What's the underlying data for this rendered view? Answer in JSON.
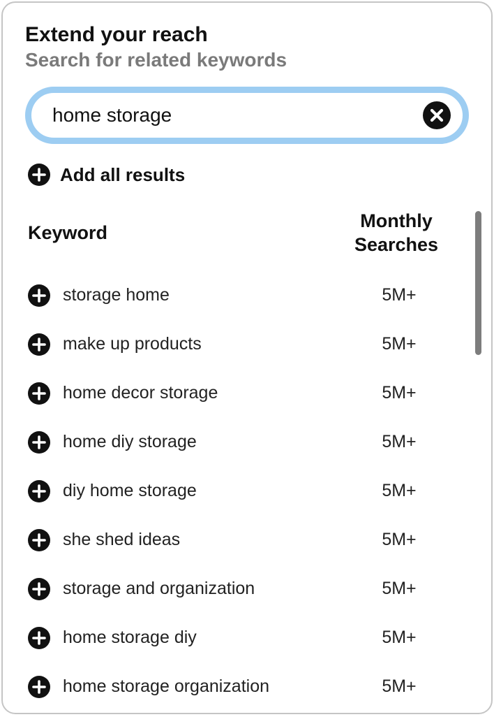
{
  "header": {
    "title": "Extend your reach",
    "subtitle": "Search for related keywords"
  },
  "search": {
    "value": "home storage",
    "placeholder": ""
  },
  "actions": {
    "add_all_label": "Add all results"
  },
  "table": {
    "columns": {
      "keyword": "Keyword",
      "searches_line1": "Monthly",
      "searches_line2": "Searches"
    },
    "rows": [
      {
        "keyword": "storage home",
        "searches": "5M+"
      },
      {
        "keyword": "make up products",
        "searches": "5M+"
      },
      {
        "keyword": "home decor storage",
        "searches": "5M+"
      },
      {
        "keyword": "home diy storage",
        "searches": "5M+"
      },
      {
        "keyword": "diy home storage",
        "searches": "5M+"
      },
      {
        "keyword": "she shed ideas",
        "searches": "5M+"
      },
      {
        "keyword": "storage and organization",
        "searches": "5M+"
      },
      {
        "keyword": "home storage diy",
        "searches": "5M+"
      },
      {
        "keyword": "home storage organization",
        "searches": "5M+"
      }
    ]
  }
}
